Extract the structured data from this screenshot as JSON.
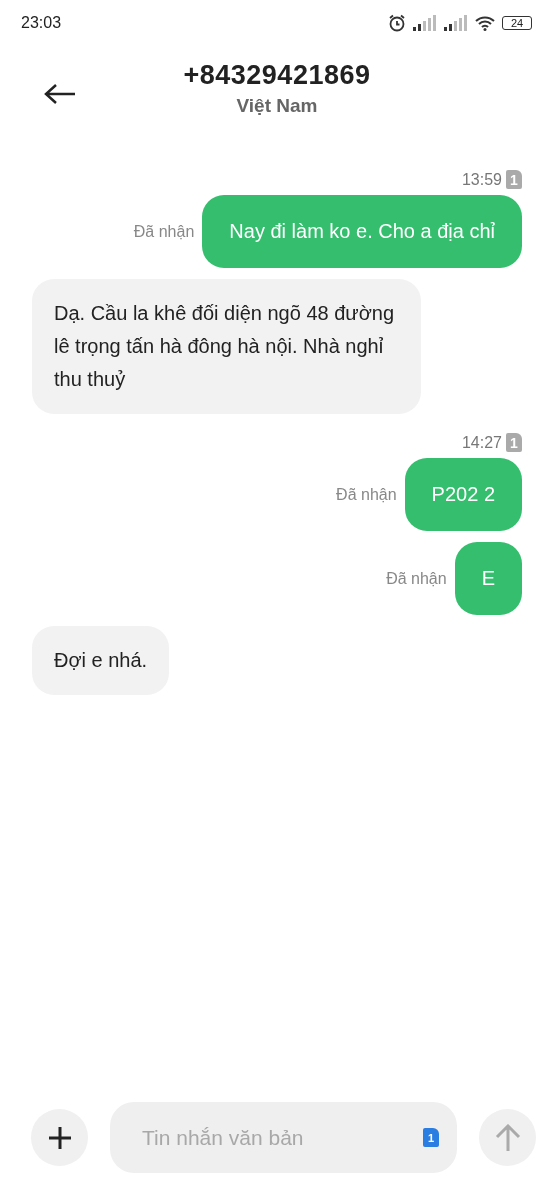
{
  "status_bar": {
    "time": "23:03",
    "battery": "24"
  },
  "header": {
    "title": "+84329421869",
    "subtitle": "Việt Nam"
  },
  "messages": [
    {
      "kind": "outgoing",
      "timestamp": "13:59",
      "sim": "1",
      "status": "Đã nhận",
      "text": "Nay đi làm ko e. Cho a địa chỉ"
    },
    {
      "kind": "incoming",
      "text": "Dạ. Cầu la khê đối diện ngõ 48 đường lê trọng tấn hà đông hà nội. Nhà nghỉ thu thuỷ"
    },
    {
      "kind": "outgoing",
      "timestamp": "14:27",
      "sim": "1",
      "status": "Đã nhận",
      "text": "P202 2"
    },
    {
      "kind": "outgoing",
      "status": "Đã nhận",
      "text": "E"
    },
    {
      "kind": "incoming",
      "text": "Đợi e nhá."
    }
  ],
  "composer": {
    "placeholder": "Tin nhắn văn bản",
    "sim": "1"
  }
}
